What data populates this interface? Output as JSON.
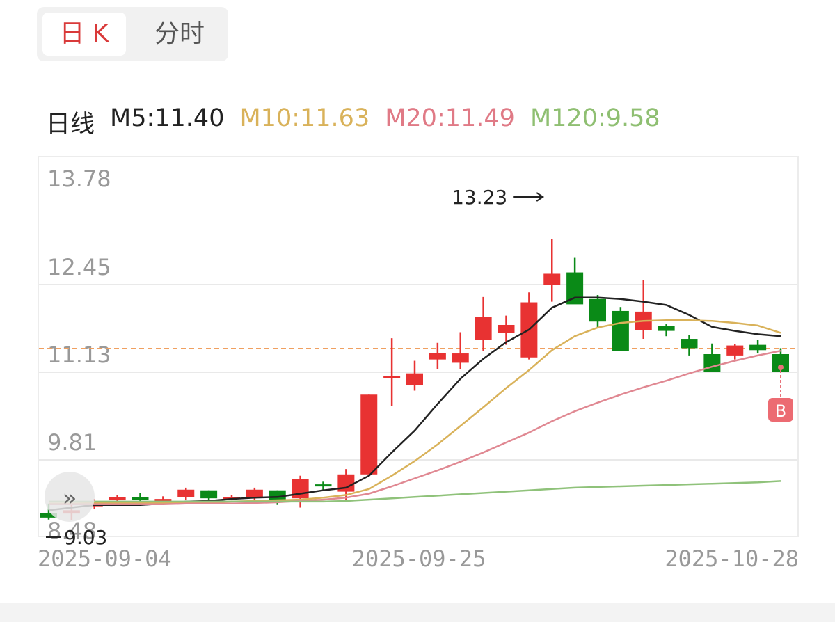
{
  "tabs": {
    "day_k": "日 K",
    "intraday": "分时"
  },
  "legend": {
    "label": "日线",
    "m5": "M5:11.40",
    "m10": "M10:11.63",
    "m20": "M20:11.49",
    "m120": "M120:9.58"
  },
  "colors": {
    "up": "#e83232",
    "down": "#0a8a17",
    "m5": "#222222",
    "m10": "#d9b25a",
    "m20": "#e08892",
    "m120": "#8fc27a",
    "last_price_line": "#f0a060",
    "grid": "#e9e9e9",
    "axis_text": "#999999"
  },
  "chart_data": {
    "type": "candlestick",
    "y_ticks": [
      "13.78",
      "12.45",
      "11.13",
      "9.81",
      "8.48"
    ],
    "ylim": [
      8.48,
      13.78
    ],
    "x_ticks": [
      "2025-09-04",
      "2025-09-25",
      "2025-10-28"
    ],
    "high_annotation": "13.23",
    "low_annotation": "9.03",
    "last_price": 11.13,
    "buy_marker": "B",
    "candles": [
      {
        "open": 8.74,
        "high": 8.88,
        "low": 8.64,
        "close": 8.67
      },
      {
        "open": 8.73,
        "high": 8.86,
        "low": 8.63,
        "close": 8.78
      },
      {
        "open": 8.84,
        "high": 8.95,
        "low": 8.8,
        "close": 8.9
      },
      {
        "open": 8.93,
        "high": 9.01,
        "low": 8.88,
        "close": 8.98
      },
      {
        "open": 8.98,
        "high": 9.04,
        "low": 8.89,
        "close": 8.94
      },
      {
        "open": 8.94,
        "high": 8.99,
        "low": 8.87,
        "close": 8.95
      },
      {
        "open": 8.98,
        "high": 9.12,
        "low": 8.93,
        "close": 9.09
      },
      {
        "open": 9.08,
        "high": 9.08,
        "low": 8.88,
        "close": 8.96
      },
      {
        "open": 8.96,
        "high": 9.01,
        "low": 8.93,
        "close": 8.98
      },
      {
        "open": 8.97,
        "high": 9.12,
        "low": 8.94,
        "close": 9.09
      },
      {
        "open": 9.08,
        "high": 9.08,
        "low": 8.86,
        "close": 8.92
      },
      {
        "open": 8.96,
        "high": 9.3,
        "low": 8.82,
        "close": 9.25
      },
      {
        "open": 9.17,
        "high": 9.21,
        "low": 9.07,
        "close": 9.14
      },
      {
        "open": 9.06,
        "high": 9.4,
        "low": 8.94,
        "close": 9.32
      },
      {
        "open": 9.32,
        "high": 10.52,
        "low": 9.32,
        "close": 10.52
      },
      {
        "open": 10.8,
        "high": 11.37,
        "low": 10.35,
        "close": 10.8
      },
      {
        "open": 10.66,
        "high": 11.03,
        "low": 10.58,
        "close": 10.84
      },
      {
        "open": 11.05,
        "high": 11.3,
        "low": 10.9,
        "close": 11.15
      },
      {
        "open": 11.0,
        "high": 11.46,
        "low": 10.9,
        "close": 11.14
      },
      {
        "open": 11.34,
        "high": 11.99,
        "low": 11.18,
        "close": 11.69
      },
      {
        "open": 11.45,
        "high": 11.71,
        "low": 11.27,
        "close": 11.57
      },
      {
        "open": 11.08,
        "high": 12.06,
        "low": 11.05,
        "close": 11.91
      },
      {
        "open": 12.17,
        "high": 12.86,
        "low": 11.92,
        "close": 12.34
      },
      {
        "open": 12.36,
        "high": 12.58,
        "low": 11.96,
        "close": 11.88
      },
      {
        "open": 11.96,
        "high": 12.02,
        "low": 11.53,
        "close": 11.62
      },
      {
        "open": 11.78,
        "high": 11.84,
        "low": 11.18,
        "close": 11.18
      },
      {
        "open": 11.49,
        "high": 12.24,
        "low": 11.36,
        "close": 11.77
      },
      {
        "open": 11.55,
        "high": 11.58,
        "low": 11.4,
        "close": 11.48
      },
      {
        "open": 11.36,
        "high": 11.42,
        "low": 11.11,
        "close": 11.22
      },
      {
        "open": 11.13,
        "high": 11.29,
        "low": 10.89,
        "close": 10.86
      },
      {
        "open": 11.11,
        "high": 11.28,
        "low": 11.05,
        "close": 11.26
      },
      {
        "open": 11.27,
        "high": 11.35,
        "low": 11.14,
        "close": 11.19
      },
      {
        "open": 11.13,
        "high": 11.22,
        "low": 10.89,
        "close": 10.86
      }
    ],
    "ma": {
      "m5": [
        8.78,
        8.82,
        8.86,
        8.86,
        8.86,
        8.88,
        8.91,
        8.92,
        8.95,
        8.97,
        8.98,
        9.03,
        9.08,
        9.12,
        9.3,
        9.65,
        9.98,
        10.38,
        10.76,
        11.06,
        11.31,
        11.5,
        11.83,
        11.98,
        11.98,
        11.96,
        11.92,
        11.87,
        11.72,
        11.54,
        11.48,
        11.43,
        11.4
      ],
      "m10": [
        8.88,
        8.88,
        8.89,
        8.89,
        8.89,
        8.89,
        8.9,
        8.9,
        8.91,
        8.92,
        8.93,
        8.94,
        8.97,
        9.01,
        9.1,
        9.3,
        9.52,
        9.77,
        10.05,
        10.33,
        10.62,
        10.89,
        11.19,
        11.4,
        11.53,
        11.6,
        11.63,
        11.64,
        11.64,
        11.63,
        11.6,
        11.56,
        11.45
      ],
      "m20": [
        8.87,
        8.87,
        8.87,
        8.87,
        8.87,
        8.87,
        8.88,
        8.88,
        8.88,
        8.89,
        8.9,
        8.92,
        8.94,
        8.97,
        9.03,
        9.14,
        9.26,
        9.38,
        9.51,
        9.65,
        9.8,
        9.95,
        10.12,
        10.27,
        10.4,
        10.52,
        10.63,
        10.73,
        10.84,
        10.94,
        11.03,
        11.11,
        11.18
      ],
      "m120": [
        8.91,
        8.91,
        8.91,
        8.91,
        8.91,
        8.91,
        8.91,
        8.91,
        8.91,
        8.91,
        8.91,
        8.91,
        8.91,
        8.92,
        8.94,
        8.96,
        8.98,
        9.0,
        9.02,
        9.04,
        9.06,
        9.08,
        9.1,
        9.12,
        9.13,
        9.14,
        9.15,
        9.16,
        9.17,
        9.18,
        9.19,
        9.2,
        9.22
      ]
    }
  }
}
